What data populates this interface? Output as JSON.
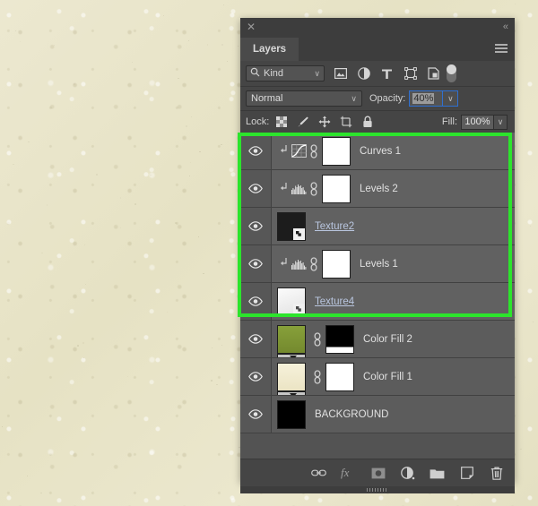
{
  "app": {
    "background_color": "#e9e5c9",
    "panel_background": "#535353",
    "selection_color": "#2ce42c",
    "accent_blue": "#2f6fd0"
  },
  "titlebar": {
    "close_label": "✕",
    "collapse_label": "«"
  },
  "tabs": [
    {
      "label": "Layers",
      "active": true
    }
  ],
  "panel_menu": {
    "label": "panel-menu"
  },
  "filter_row": {
    "kind_label": "Kind",
    "search_icon": "search-icon",
    "chevron": "∨",
    "filters": [
      {
        "name": "filter-pixel-layers",
        "icon": "image-icon"
      },
      {
        "name": "filter-adjustment-layers",
        "icon": "adjustment-icon"
      },
      {
        "name": "filter-type-layers",
        "icon": "type-icon"
      },
      {
        "name": "filter-shape-layers",
        "icon": "shape-icon"
      },
      {
        "name": "filter-smart-objects",
        "icon": "smart-object-icon"
      }
    ],
    "toggle_name": "filter-enable-toggle"
  },
  "blend_row": {
    "blend_mode": "Normal",
    "chevron": "∨",
    "opacity_label": "Opacity:",
    "opacity_value": "40%",
    "opacity_arrow": "∨"
  },
  "lock_row": {
    "lock_label": "Lock:",
    "locks": [
      {
        "name": "lock-transparent-pixels-button",
        "icon": "checkerboard-icon"
      },
      {
        "name": "lock-image-pixels-button",
        "icon": "brush-icon"
      },
      {
        "name": "lock-position-button",
        "icon": "move-icon"
      },
      {
        "name": "lock-artboard-nesting-button",
        "icon": "artboard-icon"
      },
      {
        "name": "lock-all-button",
        "icon": "lock-icon"
      }
    ],
    "fill_label": "Fill:",
    "fill_value": "100%",
    "fill_arrow": "∨"
  },
  "layers": [
    {
      "name": "Curves 1",
      "type": "adjustment",
      "adj_icon": "curves-icon",
      "clipped": true,
      "linked": true,
      "mask_color": "#ffffff",
      "visible": true,
      "selected": true
    },
    {
      "name": "Levels 2",
      "type": "adjustment",
      "adj_icon": "levels-icon",
      "clipped": true,
      "linked": true,
      "mask_color": "#ffffff",
      "visible": true,
      "selected": true
    },
    {
      "name": "Texture2",
      "type": "smart-object",
      "thumb_color": "#1c1c1c",
      "clipped": false,
      "linked": false,
      "visible": true,
      "selected": true
    },
    {
      "name": "Levels 1",
      "type": "adjustment",
      "adj_icon": "levels-icon",
      "clipped": true,
      "linked": true,
      "mask_color": "#ffffff",
      "visible": true,
      "selected": true
    },
    {
      "name": "Texture4",
      "type": "smart-object",
      "thumb_color": "#e8e8e8",
      "clipped": false,
      "linked": false,
      "visible": true,
      "selected": true
    },
    {
      "name": "Color Fill 2",
      "type": "gradient-fill",
      "thumb_color": "#7b9233",
      "mask_color": "#000000",
      "mask_stripe": "#ffffff",
      "linked": true,
      "clipped": false,
      "visible": true,
      "selected": false
    },
    {
      "name": "Color Fill 1",
      "type": "gradient-fill",
      "thumb_color": "#f2ecd2",
      "mask_color": "#ffffff",
      "linked": true,
      "clipped": false,
      "visible": true,
      "selected": false
    },
    {
      "name": "BACKGROUND",
      "type": "pixel",
      "thumb_color": "#000000",
      "clipped": false,
      "linked": false,
      "visible": true,
      "selected": false
    }
  ],
  "footer": {
    "buttons": [
      {
        "name": "link-layers-button",
        "icon": "link-icon",
        "label": "Link layers"
      },
      {
        "name": "layer-style-button",
        "icon": "fx-icon",
        "label": "fx"
      },
      {
        "name": "add-layer-mask-button",
        "icon": "add-mask-icon",
        "label": "Add layer mask"
      },
      {
        "name": "new-adjustment-layer-button",
        "icon": "adjustment-icon",
        "label": "New fill or adjustment layer"
      },
      {
        "name": "new-group-button",
        "icon": "folder-icon",
        "label": "Create a new group"
      },
      {
        "name": "new-layer-button",
        "icon": "new-layer-icon",
        "label": "Create a new layer"
      },
      {
        "name": "delete-layer-button",
        "icon": "trash-icon",
        "label": "Delete layer"
      }
    ]
  }
}
